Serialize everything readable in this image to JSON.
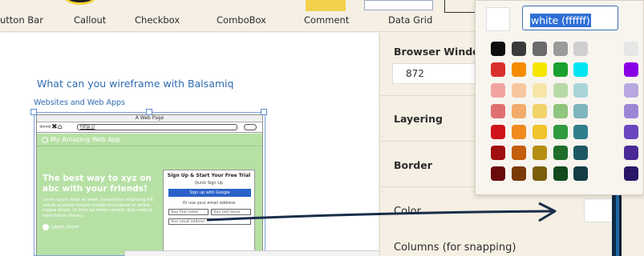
{
  "library": {
    "items": [
      "utton Bar",
      "Callout",
      "Checkbox",
      "ComboBox",
      "Comment",
      "Data Grid"
    ]
  },
  "canvas": {
    "title": "What can you wireframe with Balsamiq",
    "subtitle": "Websites and Web Apps",
    "mockup": {
      "window_title": "A Web Page",
      "nav_glyphs": "⇦⇨✖⌂",
      "url": "http://",
      "brand": "My Amazing Web App",
      "hero": "The best way to xyz on abc with your friends!",
      "lorem": "Lorem ipsum dolor sit amet, consectetur adipiscing elit, sed do eiusmod tempor incididunt ut labore et dolore magna aliqua. Ut enim ad minim veniam, quis nostrud exercitation ullamco.",
      "learn_more": "Learn more",
      "form": {
        "title": "Sign Up & Start Your Free Trial",
        "quick": "Quick Sign Up",
        "google": "Sign up with Google",
        "or": "Or use your email address",
        "first_name": "Your first name",
        "last_name": "Your last name",
        "email": "Your email address"
      }
    }
  },
  "properties": {
    "browser_window_label": "Browser Window",
    "width_value": "872",
    "layering_label": "Layering",
    "border_label": "Border",
    "color_label": "Color",
    "columns_label": "Columns (for snapping)"
  },
  "color_picker": {
    "hex_value": "white (ffffff)",
    "swatches": [
      [
        "#0d0d0d",
        "#3a3a3a",
        "#6b6b6b",
        "#9a9a9a",
        "#cfcfcf",
        "#e6e6e6"
      ],
      [
        "#d9302c",
        "#f58b00",
        "#f5e600",
        "#1aa12f",
        "#00e5f0",
        "#8a00e6"
      ],
      [
        "#f2a3a0",
        "#f7c7a0",
        "#f7e4a8",
        "#b7d9a6",
        "#a8d4d8",
        "#b9a8e0"
      ],
      [
        "#e07070",
        "#f2ab6a",
        "#f2d36a",
        "#8fc57e",
        "#7fb5bc",
        "#9d86d6"
      ],
      [
        "#d0121a",
        "#f08a1e",
        "#f0c22c",
        "#2f9a3f",
        "#2f7f8c",
        "#6a45c0"
      ],
      [
        "#a01010",
        "#c25e0c",
        "#b58d12",
        "#1f6e2a",
        "#1f5864",
        "#4a2a96"
      ],
      [
        "#6a0a0a",
        "#7a3a08",
        "#7a5e0a",
        "#134a1c",
        "#143c44",
        "#2a1666"
      ]
    ]
  }
}
